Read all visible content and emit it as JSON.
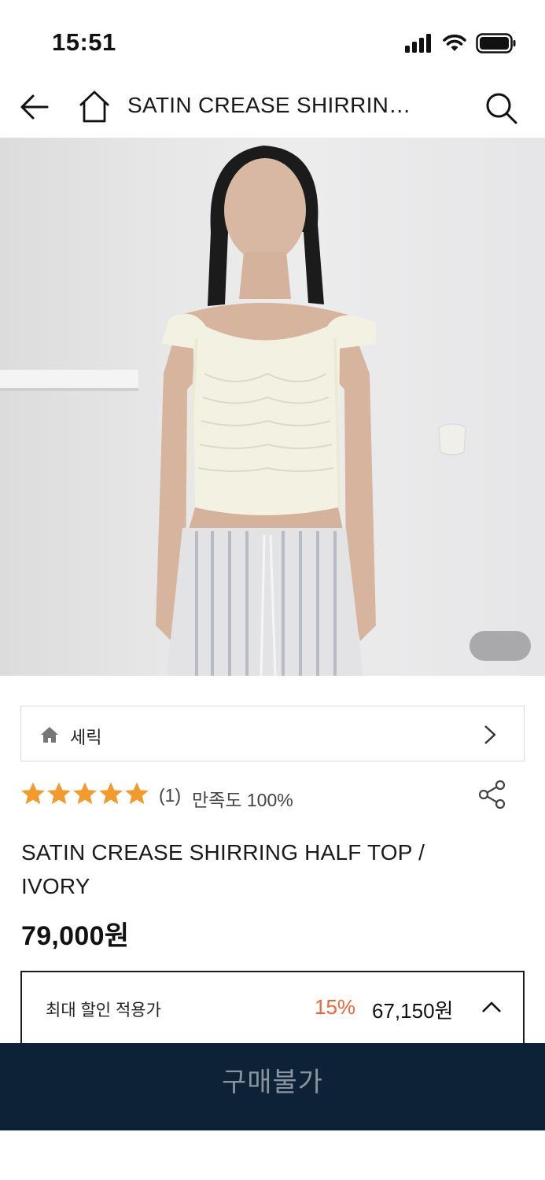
{
  "status": {
    "time": "15:51",
    "icons": [
      "signal-icon",
      "wifi-icon",
      "battery-icon"
    ]
  },
  "nav": {
    "title": "SATIN CREASE SHIRRING HALF TOP / IVORY",
    "icons": [
      "back-arrow-icon",
      "home-icon",
      "search-icon"
    ]
  },
  "hero": {
    "image": "product-model-photo",
    "pager_indicator": ""
  },
  "brand": {
    "name": "세릭"
  },
  "rating": {
    "stars": 5,
    "max_stars": 5,
    "count": "(1)",
    "satisfaction": "만족도 100%",
    "star_color": "#f29a2e"
  },
  "product": {
    "title": "SATIN CREASE SHIRRING HALF TOP / IVORY",
    "price": "79,000원"
  },
  "discount": {
    "label": "최대 할인 적용가",
    "rate": "15%",
    "price": "67,150원",
    "rate_color": "#f0643a"
  },
  "buy": {
    "label": "구매불가",
    "background": "#0d2236"
  }
}
